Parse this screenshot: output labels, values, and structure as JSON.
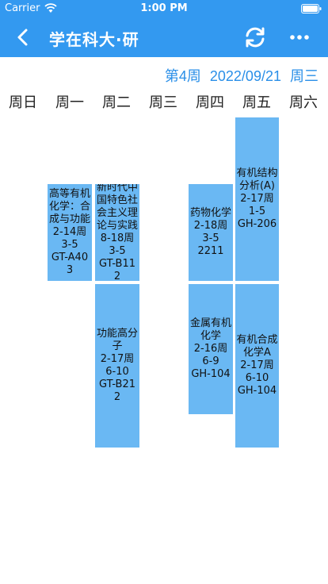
{
  "status_bar": {
    "carrier": "Carrier",
    "time": "1:00 PM"
  },
  "nav": {
    "title": "学在科大·研",
    "icons": [
      "back-icon",
      "refresh-icon",
      "more-icon"
    ]
  },
  "week_info": {
    "week": "第4周",
    "date": "2022/09/21",
    "weekday": "周三"
  },
  "weekdays": [
    "周日",
    "周一",
    "周二",
    "周三",
    "周四",
    "周五",
    "周六"
  ],
  "courses": [
    {
      "name": "高等有机化学：合成与功能",
      "weeks": "2-14周",
      "periods": "3-5",
      "room": "GT-A403"
    },
    {
      "name": "新时代中国特色社会主义理论与实践",
      "weeks": "8-18周",
      "periods": "3-5",
      "room": "GT-B112"
    },
    {
      "name": "功能高分子",
      "weeks": "2-17周",
      "periods": "6-10",
      "room": "GT-B212"
    },
    {
      "name": "药物化学",
      "weeks": "2-18周",
      "periods": "3-5",
      "room": "2211"
    },
    {
      "name": "金属有机化学",
      "weeks": "2-16周",
      "periods": "6-9",
      "room": "GH-104"
    },
    {
      "name": "有机结构分析(A)",
      "weeks": "2-17周",
      "periods": "1-5",
      "room": "GH-206"
    },
    {
      "name": "有机合成化学A",
      "weeks": "2-17周",
      "periods": "6-10",
      "room": "GH-104"
    }
  ],
  "colors": {
    "primary": "#3399f0",
    "course_block": "#6ab8f3",
    "week_text": "#2a8fe8"
  }
}
